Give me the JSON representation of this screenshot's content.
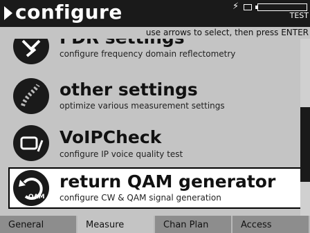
{
  "header": {
    "title": "configure",
    "status_text": "TEST"
  },
  "hint": "use arrows to select, then press ENTER",
  "items": [
    {
      "name": "FDR settings",
      "desc": "configure frequency domain reflectometry"
    },
    {
      "name": "other settings",
      "desc": "optimize various measurement settings"
    },
    {
      "name": "VoIPCheck",
      "desc": "configure IP voice quality test"
    },
    {
      "name": "return QAM generator",
      "desc": "configure CW & QAM signal generation",
      "icon_text": "QAM"
    }
  ],
  "tabs": [
    "General",
    "Measure",
    "Chan Plan",
    "Access"
  ],
  "colors": {
    "header": "#1a1a1a",
    "background": "#c4c4c4",
    "selected": "#ffffff"
  }
}
